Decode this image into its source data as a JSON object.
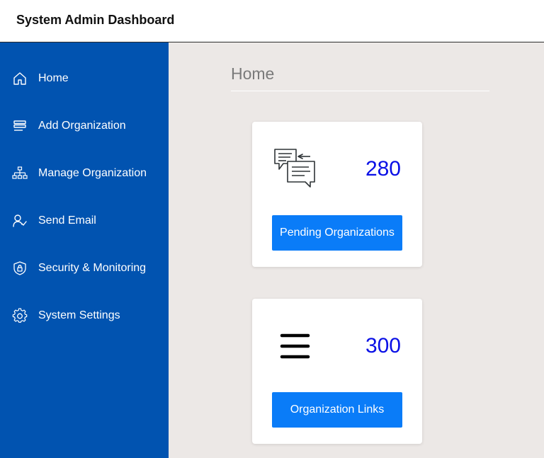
{
  "header": {
    "title": "System Admin Dashboard"
  },
  "sidebar": {
    "background": "#0153b0",
    "items": [
      {
        "label": "Home",
        "icon": "home-icon"
      },
      {
        "label": "Add Organization",
        "icon": "stack-icon"
      },
      {
        "label": "Manage Organization",
        "icon": "org-chart-icon"
      },
      {
        "label": "Send Email",
        "icon": "user-check-icon"
      },
      {
        "label": "Security & Monitoring",
        "icon": "shield-lock-icon"
      },
      {
        "label": "System Settings",
        "icon": "gear-icon"
      }
    ]
  },
  "main": {
    "title": "Home",
    "cards": [
      {
        "count": "280",
        "button_label": "Pending Organizations",
        "icon": "chat-bubbles-icon"
      },
      {
        "count": "300",
        "button_label": "Organization Links",
        "icon": "hamburger-menu-icon"
      }
    ]
  },
  "colors": {
    "accent": "#0a7cf8",
    "count": "#0a10e6",
    "page_bg": "#ece8e6"
  }
}
